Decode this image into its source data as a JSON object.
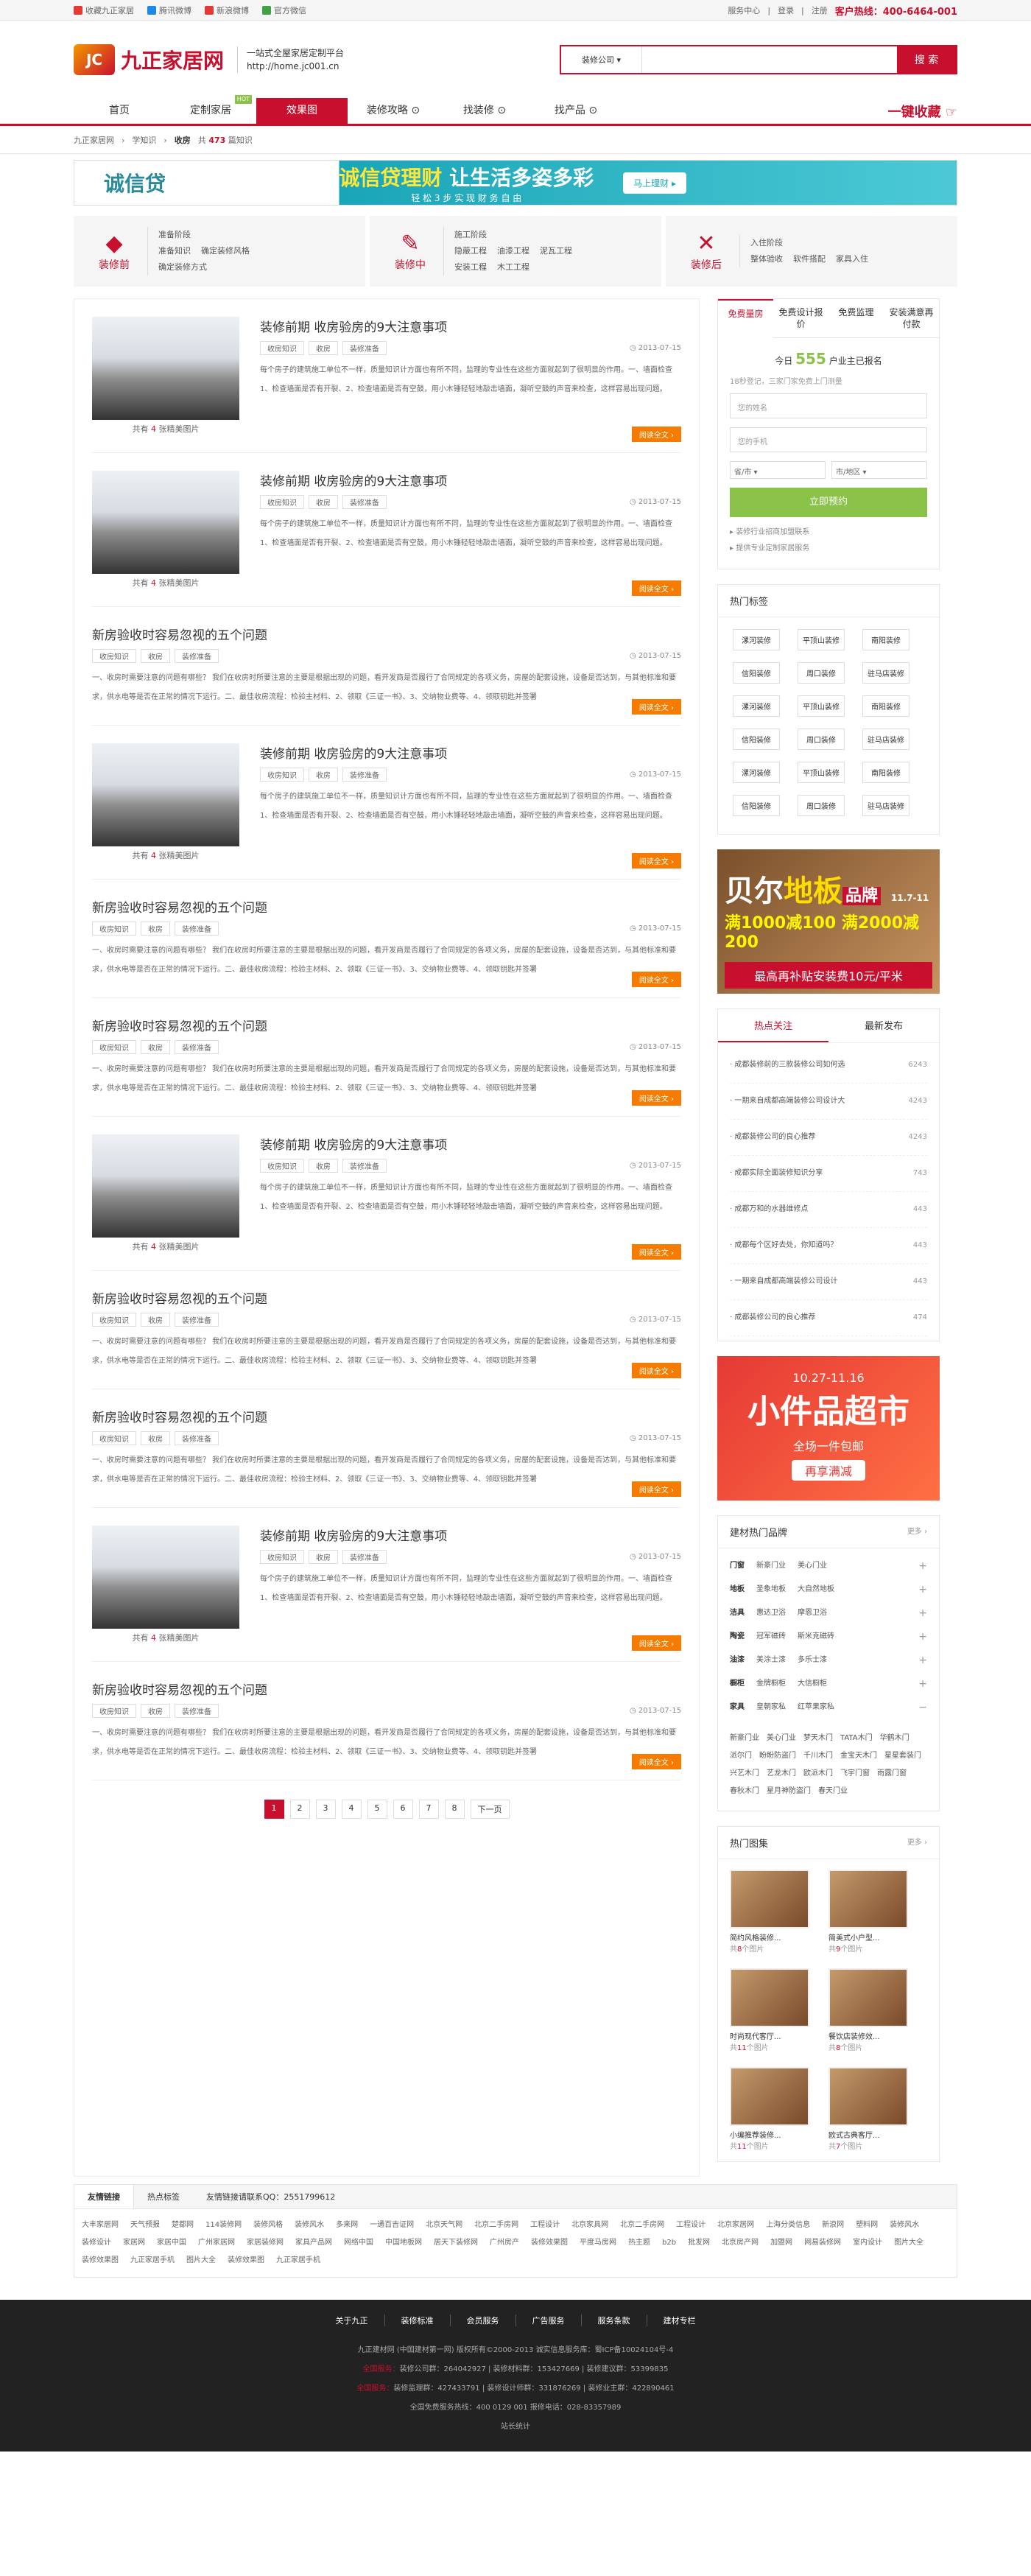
{
  "topbar": {
    "left": [
      "收藏九正家居",
      "腾讯微博",
      "新浪微博",
      "官方微信"
    ],
    "right": [
      "服务中心",
      "登录",
      "注册"
    ],
    "hotline": "客户热线：400-6464-001"
  },
  "header": {
    "logo": "九正家居网",
    "slogan1": "一站式全屋家居定制平台",
    "slogan2": "http://home.jc001.cn",
    "search_type": "装修公司 ▾",
    "search_btn": "搜 索"
  },
  "nav": {
    "items": [
      "首页",
      "定制家居",
      "效果图",
      "装修攻略",
      "找装修",
      "找产品"
    ],
    "badge": "HOT",
    "collect": "一键收藏"
  },
  "crumb": {
    "items": [
      "九正家居网",
      "学知识",
      "收房"
    ],
    "count_prefix": "共",
    "count": "473",
    "count_suffix": "篇知识"
  },
  "banner": {
    "logo": "诚信贷",
    "main1": "诚信贷理财",
    "main2": "让生活多姿多彩",
    "sub": "轻 松 3 步   实 现 财 务 自 由",
    "btn": "马上理财 ▸"
  },
  "stages": [
    {
      "name": "装修前",
      "icon": "◆",
      "title": "准备阶段",
      "items": [
        "准备知识",
        "确定装修风格",
        "确定装修方式"
      ]
    },
    {
      "name": "装修中",
      "icon": "✎",
      "title": "施工阶段",
      "items": [
        "隐蔽工程",
        "油漆工程",
        "泥瓦工程",
        "安装工程",
        "木工工程"
      ]
    },
    {
      "name": "装修后",
      "icon": "✕",
      "title": "入住阶段",
      "items": [
        "整体验收",
        "软件搭配",
        "家具入住"
      ]
    }
  ],
  "articles": [
    {
      "img": true,
      "title": "装修前期 收房验房的9大注意事项",
      "tags": [
        "收房知识",
        "收房",
        "装修准备"
      ],
      "date": "2013-07-15",
      "count": "4",
      "cap_pre": "共有",
      "cap_suf": "张精美图片",
      "desc": "每个房子的建筑施工单位不一样，质量知识计方面也有所不同，监理的专业性在这些方面就起到了很明显的作用。一、墙面检查  1、检查墙面是否有开裂、2、检查墙面是否有空鼓，用小木锤轻轻地敲击墙面，凝听空鼓的声音来检查，这样容易出现问题。",
      "more": "阅读全文 ›"
    },
    {
      "img": true,
      "title": "装修前期 收房验房的9大注意事项",
      "tags": [
        "收房知识",
        "收房",
        "装修准备"
      ],
      "date": "2013-07-15",
      "count": "4",
      "cap_pre": "共有",
      "cap_suf": "张精美图片",
      "desc": "每个房子的建筑施工单位不一样，质量知识计方面也有所不同，监理的专业性在这些方面就起到了很明显的作用。一、墙面检查  1、检查墙面是否有开裂、2、检查墙面是否有空鼓，用小木锤轻轻地敲击墙面，凝听空鼓的声音来检查，这样容易出现问题。",
      "more": "阅读全文 ›"
    },
    {
      "img": false,
      "title": "新房验收时容易忽视的五个问题",
      "tags": [
        "收房知识",
        "收房",
        "装修准备"
      ],
      "date": "2013-07-15",
      "desc": "一、收房时需要注意的问题有哪些？ 我们在收房时所要注意的主要是根据出现的问题，看开发商是否履行了合同规定的各项义务，房屋的配套设施，设备是否达到，与其他标准和要求，供水电等是否在正常的情况下运行。二、最佳收房流程：检验主材料、2、领取《三证一书》、3、交纳物业费等、4、领取钥匙并签署",
      "more": "阅读全文 ›"
    },
    {
      "img": true,
      "title": "装修前期 收房验房的9大注意事项",
      "tags": [
        "收房知识",
        "收房",
        "装修准备"
      ],
      "date": "2013-07-15",
      "count": "4",
      "cap_pre": "共有",
      "cap_suf": "张精美图片",
      "desc": "每个房子的建筑施工单位不一样，质量知识计方面也有所不同，监理的专业性在这些方面就起到了很明显的作用。一、墙面检查  1、检查墙面是否有开裂、2、检查墙面是否有空鼓，用小木锤轻轻地敲击墙面，凝听空鼓的声音来检查，这样容易出现问题。",
      "more": "阅读全文 ›"
    },
    {
      "img": false,
      "title": "新房验收时容易忽视的五个问题",
      "tags": [
        "收房知识",
        "收房",
        "装修准备"
      ],
      "date": "2013-07-15",
      "desc": "一、收房时需要注意的问题有哪些？ 我们在收房时所要注意的主要是根据出现的问题，看开发商是否履行了合同规定的各项义务，房屋的配套设施，设备是否达到，与其他标准和要求，供水电等是否在正常的情况下运行。二、最佳收房流程：检验主材料、2、领取《三证一书》、3、交纳物业费等、4、领取钥匙并签署",
      "more": "阅读全文 ›"
    },
    {
      "img": false,
      "title": "新房验收时容易忽视的五个问题",
      "tags": [
        "收房知识",
        "收房",
        "装修准备"
      ],
      "date": "2013-07-15",
      "desc": "一、收房时需要注意的问题有哪些？ 我们在收房时所要注意的主要是根据出现的问题，看开发商是否履行了合同规定的各项义务，房屋的配套设施，设备是否达到，与其他标准和要求，供水电等是否在正常的情况下运行。二、最佳收房流程：检验主材料、2、领取《三证一书》、3、交纳物业费等、4、领取钥匙并签署",
      "more": "阅读全文 ›"
    },
    {
      "img": true,
      "title": "装修前期 收房验房的9大注意事项",
      "tags": [
        "收房知识",
        "收房",
        "装修准备"
      ],
      "date": "2013-07-15",
      "count": "4",
      "cap_pre": "共有",
      "cap_suf": "张精美图片",
      "desc": "每个房子的建筑施工单位不一样，质量知识计方面也有所不同，监理的专业性在这些方面就起到了很明显的作用。一、墙面检查  1、检查墙面是否有开裂、2、检查墙面是否有空鼓，用小木锤轻轻地敲击墙面，凝听空鼓的声音来检查，这样容易出现问题。",
      "more": "阅读全文 ›"
    },
    {
      "img": false,
      "title": "新房验收时容易忽视的五个问题",
      "tags": [
        "收房知识",
        "收房",
        "装修准备"
      ],
      "date": "2013-07-15",
      "desc": "一、收房时需要注意的问题有哪些？ 我们在收房时所要注意的主要是根据出现的问题，看开发商是否履行了合同规定的各项义务，房屋的配套设施，设备是否达到，与其他标准和要求，供水电等是否在正常的情况下运行。二、最佳收房流程：检验主材料、2、领取《三证一书》、3、交纳物业费等、4、领取钥匙并签署",
      "more": "阅读全文 ›"
    },
    {
      "img": false,
      "title": "新房验收时容易忽视的五个问题",
      "tags": [
        "收房知识",
        "收房",
        "装修准备"
      ],
      "date": "2013-07-15",
      "desc": "一、收房时需要注意的问题有哪些？ 我们在收房时所要注意的主要是根据出现的问题，看开发商是否履行了合同规定的各项义务，房屋的配套设施，设备是否达到，与其他标准和要求，供水电等是否在正常的情况下运行。二、最佳收房流程：检验主材料、2、领取《三证一书》、3、交纳物业费等、4、领取钥匙并签署",
      "more": "阅读全文 ›"
    },
    {
      "img": true,
      "title": "装修前期 收房验房的9大注意事项",
      "tags": [
        "收房知识",
        "收房",
        "装修准备"
      ],
      "date": "2013-07-15",
      "count": "4",
      "cap_pre": "共有",
      "cap_suf": "张精美图片",
      "desc": "每个房子的建筑施工单位不一样，质量知识计方面也有所不同，监理的专业性在这些方面就起到了很明显的作用。一、墙面检查  1、检查墙面是否有开裂、2、检查墙面是否有空鼓，用小木锤轻轻地敲击墙面，凝听空鼓的声音来检查，这样容易出现问题。",
      "more": "阅读全文 ›"
    },
    {
      "img": false,
      "title": "新房验收时容易忽视的五个问题",
      "tags": [
        "收房知识",
        "收房",
        "装修准备"
      ],
      "date": "2013-07-15",
      "desc": "一、收房时需要注意的问题有哪些？ 我们在收房时所要注意的主要是根据出现的问题，看开发商是否履行了合同规定的各项义务，房屋的配套设施，设备是否达到，与其他标准和要求，供水电等是否在正常的情况下运行。二、最佳收房流程：检验主材料、2、领取《三证一书》、3、交纳物业费等、4、领取钥匙并签署",
      "more": "阅读全文 ›"
    }
  ],
  "pager": {
    "pages": [
      "1",
      "2",
      "3",
      "4",
      "5",
      "6",
      "7",
      "8"
    ],
    "next": "下一页"
  },
  "quote": {
    "tabs": [
      "免费量房",
      "免费设计报价",
      "免费监理",
      "安装满意再付款"
    ],
    "today_pre": "今日",
    "today_num": "555",
    "today_suf": "户业主已报名",
    "hint": "18秒登记，三家门家免费上门测量",
    "name_ph": "您的姓名",
    "phone_ph": "您的手机",
    "prov": "省/市 ▾",
    "city": "市/地区 ▾",
    "submit": "立即预约",
    "notes": [
      "装修行业招商加盟联系",
      "提供专业定制家居服务"
    ]
  },
  "tagbox": {
    "title": "热门标签",
    "tags": [
      "漯河装修",
      "平顶山装修",
      "南阳装修",
      "信阳装修",
      "周口装修",
      "驻马店装修",
      "漯河装修",
      "平顶山装修",
      "南阳装修",
      "信阳装修",
      "周口装修",
      "驻马店装修",
      "漯河装修",
      "平顶山装修",
      "南阳装修",
      "信阳装修",
      "周口装修",
      "驻马店装修"
    ]
  },
  "ad1": {
    "brand1": "贝尔",
    "brand2": "地板",
    "brand3": "品牌",
    "date": "11.7-11",
    "promo": "满1000减100 满2000减200",
    "sub": "最高再补贴安装费10元/平米"
  },
  "hot": {
    "tabs": [
      "热点关注",
      "最新发布"
    ],
    "items": [
      {
        "t": "成都装修前的三款装修公司如何选",
        "n": "6243"
      },
      {
        "t": "一期来自成都高端装修公司设计大",
        "n": "4243"
      },
      {
        "t": "成都装修公司的良心推荐",
        "n": "4243"
      },
      {
        "t": "成都实际全面装修知识分享",
        "n": "743"
      },
      {
        "t": "成都万和的水器维修点",
        "n": "443"
      },
      {
        "t": "成都每个区好去处，你知道吗？",
        "n": "443"
      },
      {
        "t": "一期来自成都高端装修公司设计",
        "n": "443"
      },
      {
        "t": "成都装修公司的良心推荐",
        "n": "474"
      }
    ]
  },
  "ad2": {
    "date": "10.27-11.16",
    "title": "小件品超市",
    "line1": "全场一件包邮",
    "line2": "再享满减"
  },
  "brands": {
    "title": "建材热门品牌",
    "more": "更多 ›",
    "rows": [
      {
        "k": "门窗",
        "v": [
          "新豪门业",
          "美心门业"
        ]
      },
      {
        "k": "地板",
        "v": [
          "圣象地板",
          "大自然地板"
        ]
      },
      {
        "k": "洁具",
        "v": [
          "惠达卫浴",
          "摩恩卫浴"
        ]
      },
      {
        "k": "陶瓷",
        "v": [
          "冠军磁砖",
          "斯米克磁砖"
        ]
      },
      {
        "k": "油漆",
        "v": [
          "美涂士漆",
          "多乐士漆"
        ]
      },
      {
        "k": "橱柜",
        "v": [
          "金牌橱柜",
          "大信橱柜"
        ]
      },
      {
        "k": "家具",
        "v": [
          "皇朝家私",
          "红苹果家私"
        ]
      }
    ],
    "names": [
      "新豪门业",
      "美心门业",
      "梦天木门",
      "TATA木门",
      "华鹤木门",
      "派尔门",
      "盼盼防盗门",
      "千川木门",
      "金宝天木门",
      "星星套装门",
      "兴艺木门",
      "艺龙木门",
      "欧派木门",
      "飞宇门窗",
      "雨露门窗",
      "春秋木门",
      "星月神防盗门",
      "春天门业"
    ]
  },
  "atlas": {
    "title": "热门图集",
    "more": "更多 ›",
    "items": [
      {
        "n": "简约风格装修...",
        "c": "8"
      },
      {
        "n": "简美式小户型...",
        "c": "9"
      },
      {
        "n": "时尚现代客厅...",
        "c": "11"
      },
      {
        "n": "餐饮店装修效...",
        "c": "8"
      },
      {
        "n": "小编推荐装修...",
        "c": "11"
      },
      {
        "n": "欧式古典客厅...",
        "c": "7"
      }
    ],
    "pre": "共",
    "suf": "个图片"
  },
  "links": {
    "tabs": [
      "友情链接",
      "热点标签"
    ],
    "contact": "友情链接请联系QQ：2551799612",
    "items": [
      "大丰家居网",
      "天气预报",
      "楚都网",
      "114装修网",
      "装修风格",
      "装修风水",
      "多来网",
      "一通百吉证网",
      "北京天气网",
      "北京二手房网",
      "工程设计",
      "北京家具网",
      "北京二手房网",
      "工程设计",
      "北京家居网",
      "上海分类信息",
      "新浪网",
      "塑料网",
      "装修风水",
      "装修设计",
      "家居网",
      "家居中国",
      "广州家居网",
      "家居装修网",
      "家具产品网",
      "网络中国",
      "中国地板网",
      "居天下装修网",
      "广州房产",
      "装修效果图",
      "平度马房网",
      "热主题",
      "b2b",
      "批发网",
      "北京房产网",
      "加盟网",
      "网易装修网",
      "室内设计",
      "图片大全",
      "装修效果图",
      "九正家居手机",
      "图片大全",
      "装修效果图",
      "九正家居手机"
    ]
  },
  "footer": {
    "nav": [
      "关于九正",
      "装修标准",
      "会员服务",
      "广告服务",
      "服务条款",
      "建材专栏"
    ],
    "copy": "九正建材网 (中国建材第一网) 版权所有©2000-2013   诚实信息服务库：蜀ICP备10024104号-4",
    "lines": [
      {
        "r": "全国服务：",
        "t": "装修公司群：264042927 | 装修材料群：153427669 | 装修建议群：53399835"
      },
      {
        "r": "全国服务：",
        "t": "装修监理群：427433791 | 装修设计师群：331876269 | 装修业主群：422890461"
      },
      {
        "r": "",
        "t": "全国免费服务热线：400 0129 001  报修电话：028-83357989"
      },
      {
        "r": "",
        "t": "站长统计"
      }
    ]
  }
}
